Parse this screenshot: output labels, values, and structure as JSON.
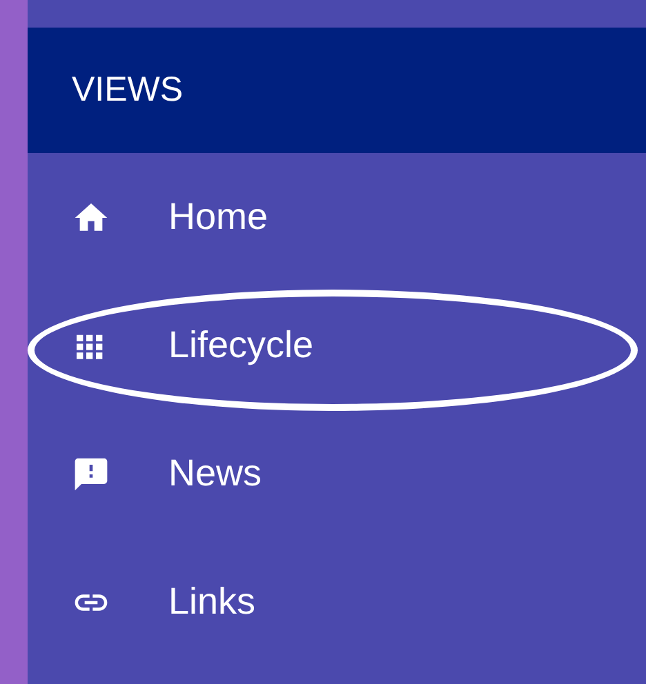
{
  "sidebar": {
    "header": "VIEWS",
    "items": [
      {
        "label": "Home",
        "circled": false
      },
      {
        "label": "Lifecycle",
        "circled": true
      },
      {
        "label": "News",
        "circled": false
      },
      {
        "label": "Links",
        "circled": false
      }
    ]
  }
}
